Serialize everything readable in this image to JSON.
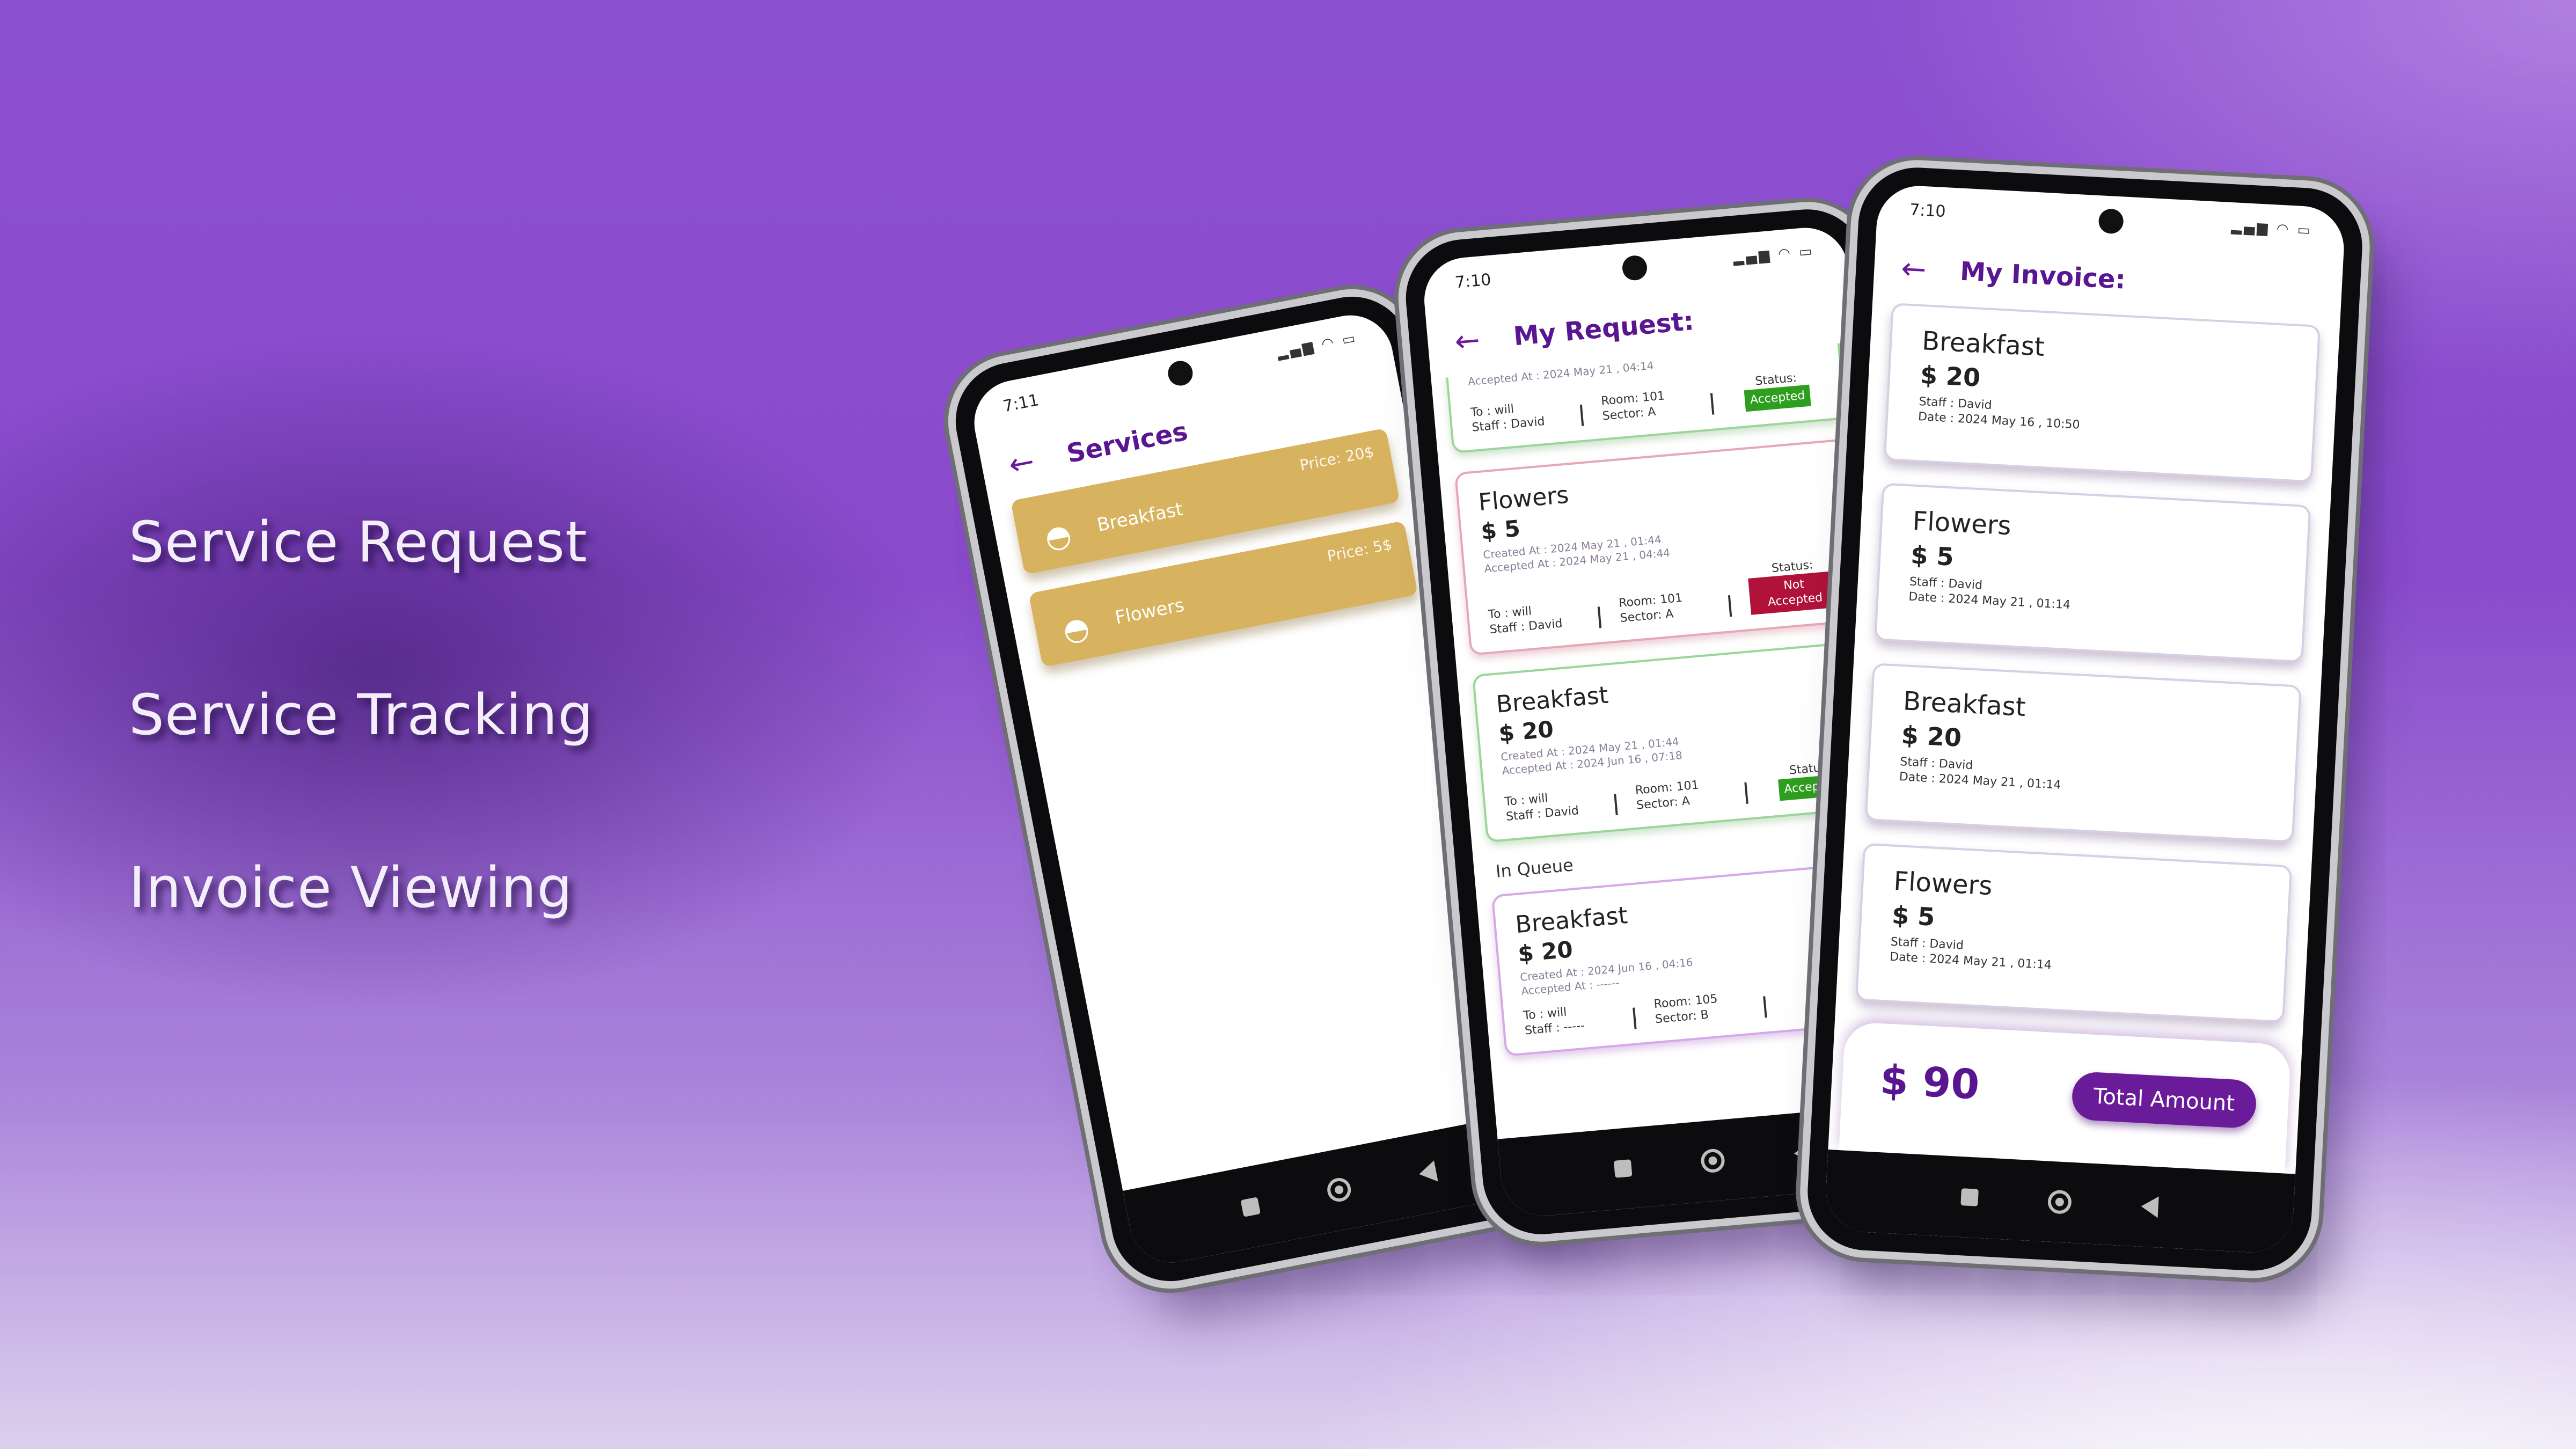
{
  "features": [
    "Service Request",
    "Service Tracking",
    "Invoice Viewing"
  ],
  "services_screen": {
    "time": "7:11",
    "title": "Services",
    "items": [
      {
        "name": "Breakfast",
        "price": "Price: 20$"
      },
      {
        "name": "Flowers",
        "price": "Price: 5$"
      }
    ]
  },
  "request_screen": {
    "time": "7:10",
    "title": "My Request:",
    "partial_card": {
      "accepted": "Accepted At : 2024 May 21 , 04:14",
      "to": "To : will",
      "staff": "Staff : David",
      "room": "Room: 101",
      "sector": "Sector: A",
      "status_label": "Status:",
      "status": "Accepted"
    },
    "cards": [
      {
        "title": "Flowers",
        "price": "$ 5",
        "created": "Created At : 2024 May 21 , 01:44",
        "accepted": "Accepted At : 2024 May 21 , 04:44",
        "to": "To : will",
        "staff": "Staff : David",
        "room": "Room: 101",
        "sector": "Sector: A",
        "status_label": "Status:",
        "status": "Not Accepted"
      },
      {
        "title": "Breakfast",
        "price": "$ 20",
        "created": "Created At : 2024 May 21 , 01:44",
        "accepted": "Accepted At : 2024 Jun 16 , 07:18",
        "to": "To : will",
        "staff": "Staff : David",
        "room": "Room: 101",
        "sector": "Sector: A",
        "status_label": "Status:",
        "status": "Accepted"
      }
    ],
    "queue_label": "In Queue",
    "queue_card": {
      "title": "Breakfast",
      "price": "$ 20",
      "created": "Created At : 2024 Jun 16 , 04:16",
      "accepted": "Accepted At : ------",
      "to": "To : will",
      "staff": "Staff : -----",
      "room": "Room: 105",
      "sector": "Sector: B"
    }
  },
  "invoice_screen": {
    "time": "7:10",
    "title": "My Invoice:",
    "items": [
      {
        "title": "Breakfast",
        "price": "$ 20",
        "staff": "Staff : David",
        "date": "Date : 2024 May 16 , 10:50"
      },
      {
        "title": "Flowers",
        "price": "$ 5",
        "staff": "Staff : David",
        "date": "Date : 2024 May 21 , 01:14"
      },
      {
        "title": "Breakfast",
        "price": "$ 20",
        "staff": "Staff : David",
        "date": "Date : 2024 May 21 , 01:14"
      },
      {
        "title": "Flowers",
        "price": "$ 5",
        "staff": "Staff : David",
        "date": "Date : 2024 May 21 , 01:14"
      }
    ],
    "total": "$ 90",
    "total_button": "Total Amount"
  },
  "colors": {
    "accent": "#6a1b9a",
    "service_card": "#d8b35f",
    "accepted": "#2e9e1e",
    "not_accepted": "#b0123a"
  },
  "icons": {
    "back": "back-arrow-icon",
    "service": "food-cloche-icon"
  }
}
